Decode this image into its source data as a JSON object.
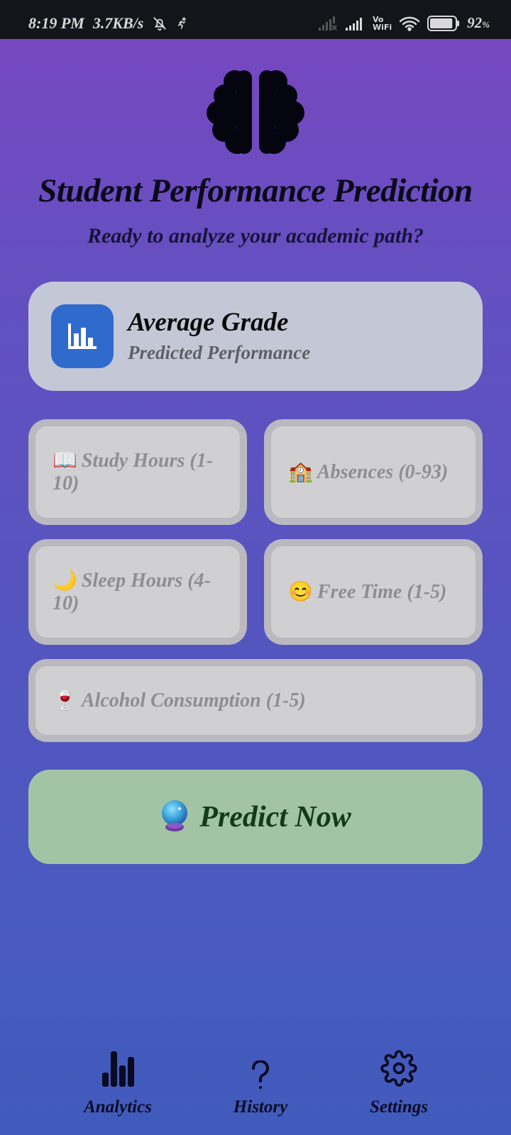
{
  "status_bar": {
    "time": "8:19 PM",
    "net_speed": "3.7KB/s",
    "vo_label": "Vo",
    "wifi_label": "WiFi",
    "battery_percent": "92",
    "battery_unit": "%",
    "battery_level": 0.92,
    "icons": [
      "bell-off-icon",
      "activity-icon",
      "signal-none-icon",
      "signal-icon",
      "wifi-icon",
      "battery-icon"
    ]
  },
  "header": {
    "logo_icon": "brain-icon",
    "title": "Student Performance Prediction",
    "subtitle": "Ready to analyze your academic path?"
  },
  "grade_card": {
    "icon": "bar-chart-icon",
    "title": "Average Grade",
    "subtitle": "Predicted Performance"
  },
  "fields": [
    {
      "emoji": "📖",
      "label": "Study Hours (1-10)"
    },
    {
      "emoji": "🏫",
      "label": "Absences (0-93)"
    },
    {
      "emoji": "🌙",
      "label": "Sleep Hours (4-10)"
    },
    {
      "emoji": "😊",
      "label": "Free Time (1-5)"
    },
    {
      "emoji": "🍷",
      "label": "Alcohol Consumption (1-5)"
    }
  ],
  "predict_button": {
    "icon": "crystal-ball-icon",
    "label": "Predict Now"
  },
  "bottom_nav": [
    {
      "label": "Analytics",
      "icon": "bar-chart-icon"
    },
    {
      "label": "History",
      "icon": "question-mark-icon"
    },
    {
      "label": "Settings",
      "icon": "gear-icon"
    }
  ],
  "colors": {
    "grade_icon_bg": "#2f6bcc",
    "predict_bg": "#a2c4a4",
    "predict_text": "#143a1c",
    "card_bg": "#c4c8d6"
  }
}
